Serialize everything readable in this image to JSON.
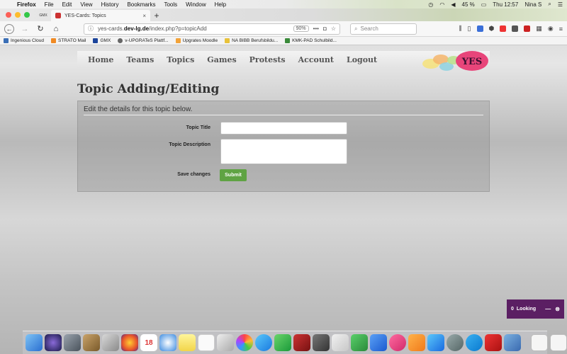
{
  "menubar": {
    "app": "Firefox",
    "items": [
      "File",
      "Edit",
      "View",
      "History",
      "Bookmarks",
      "Tools",
      "Window",
      "Help"
    ],
    "battery": "45 %",
    "clock": "Thu 12:57",
    "user": "Nina S"
  },
  "tabs": {
    "inactive_label": "GMX",
    "active_label": "YES-Cards: Topics"
  },
  "navbar": {
    "url_prefix": "yes-cards.",
    "url_domain": "dev-lg.de",
    "url_path": "/index.php?p=topicAdd",
    "zoom": "90%",
    "search_placeholder": "Search"
  },
  "bookmarks": [
    {
      "label": "Ingenious Cloud",
      "color": "#3b6fb6"
    },
    {
      "label": "STRATO Mail",
      "color": "#f08a24"
    },
    {
      "label": "GMX",
      "color": "#1c449b"
    },
    {
      "label": "v-UPGRATeS Plattf...",
      "color": "#666666"
    },
    {
      "label": "Upgrates Moodle",
      "color": "#f2a33a"
    },
    {
      "label": "NA BIBB Berufsbildu...",
      "color": "#e8c23a"
    },
    {
      "label": "KMK-PAD Schulbild...",
      "color": "#3a8a3a"
    }
  ],
  "sitenav": {
    "items": [
      "Home",
      "Teams",
      "Topics",
      "Games",
      "Protests",
      "Account",
      "Logout"
    ],
    "logo_text": "YES"
  },
  "page": {
    "title": "Topic Adding/Editing",
    "intro": "Edit the details for this topic below.",
    "topic_title_label": "Topic Title",
    "topic_description_label": "Topic Description",
    "save_changes_label": "Save changes",
    "submit_label": "Submit",
    "topic_title_value": "",
    "topic_description_value": ""
  },
  "widget": {
    "count": "0",
    "label": "Looking",
    "minimize": "—",
    "close": "⊗"
  },
  "dock": {
    "calendar_day": "18"
  },
  "colors": {
    "submit": "#5fa343",
    "widget": "#5b1f63",
    "logo_bubble": "#e8457a"
  }
}
